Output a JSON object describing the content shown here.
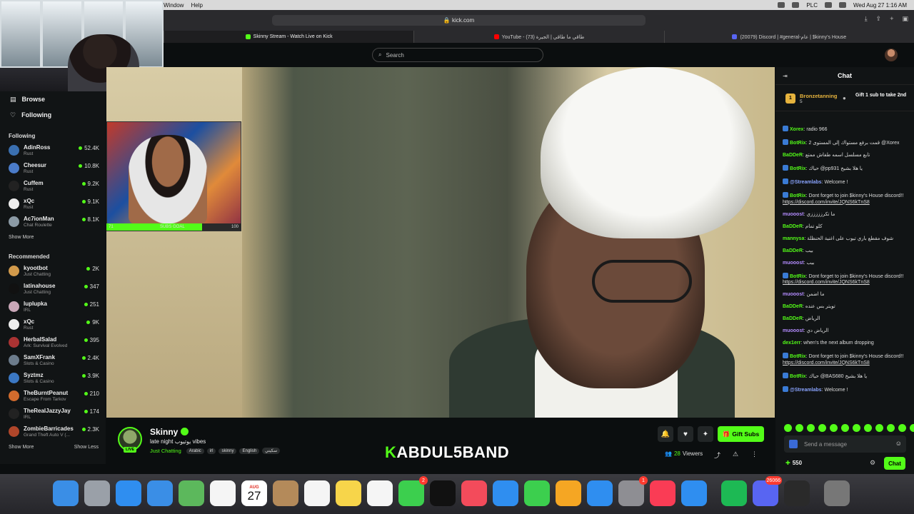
{
  "menubar": {
    "items": [
      "Window",
      "Help"
    ],
    "status": "PLC",
    "datetime": "Wed Aug 27  1:16 AM"
  },
  "browser": {
    "url": "kick.com",
    "tabs": [
      {
        "title": "Skinny Stream - Watch Live on Kick",
        "color": "#53fc18"
      },
      {
        "title": "YouTube - (73) طاقي ما طاقي | الجيرة",
        "color": "#ff0000"
      },
      {
        "title": "(20079) Discord | #general-عام | $kinny's House",
        "color": "#5865f2"
      }
    ]
  },
  "header": {
    "search_placeholder": "Search"
  },
  "sidebar": {
    "nav": [
      {
        "label": "Browse",
        "icon": "browse-icon"
      },
      {
        "label": "Following",
        "icon": "heart-icon"
      }
    ],
    "following_title": "Following",
    "following": [
      {
        "name": "AdinRoss",
        "category": "Rust",
        "viewers": "52.4K",
        "color": "#3a6fb0"
      },
      {
        "name": "Cheesur",
        "category": "Rust",
        "viewers": "10.8K",
        "color": "#4b7cc9"
      },
      {
        "name": "Cuffem",
        "category": "Rust",
        "viewers": "9.2K",
        "color": "#222"
      },
      {
        "name": "xQc",
        "category": "Rust",
        "viewers": "9.1K",
        "color": "#eee"
      },
      {
        "name": "Ac7ionMan",
        "category": "Chat Roulette",
        "viewers": "8.1K",
        "color": "#8b9aa5"
      }
    ],
    "show_more": "Show More",
    "recommended_title": "Recommended",
    "recommended": [
      {
        "name": "kyootbot",
        "category": "Just Chatting",
        "viewers": "2K",
        "color": "#d29a4b"
      },
      {
        "name": "latinahouse",
        "category": "Just Chatting",
        "viewers": "347",
        "color": "#111"
      },
      {
        "name": "luplupka",
        "category": "IRL",
        "viewers": "251",
        "color": "#c9a7b8"
      },
      {
        "name": "xQc",
        "category": "Rust",
        "viewers": "9K",
        "color": "#eee"
      },
      {
        "name": "HerbalSalad",
        "category": "Ark: Survival Evolved",
        "viewers": "395",
        "color": "#a33"
      },
      {
        "name": "SamXFrank",
        "category": "Slots & Casino",
        "viewers": "2.4K",
        "color": "#6c7c8c"
      },
      {
        "name": "Syztmz",
        "category": "Slots & Casino",
        "viewers": "3.9K",
        "color": "#3b78c4"
      },
      {
        "name": "TheBurntPeanut",
        "category": "Escape From Tarkov",
        "viewers": "210",
        "color": "#d26b2d"
      },
      {
        "name": "TheRealJazzyJay",
        "category": "IRL",
        "viewers": "174",
        "color": "#222"
      },
      {
        "name": "ZombieBarricades",
        "category": "Grand Theft Auto V (...",
        "viewers": "2.3K",
        "color": "#b0462a"
      }
    ],
    "show_more_2": "Show More",
    "show_less": "Show Less"
  },
  "overlay": {
    "subs_goal_label": "SUBS GOAL",
    "subs_current": "71",
    "subs_target": "100",
    "subs_progress": 0.71
  },
  "stream": {
    "channel": "Skinny",
    "live": "LIVE",
    "title": "late night يوتيوب vibes",
    "category": "Just Chatting",
    "tags": [
      "Arabic",
      "irl",
      "skinny",
      "English",
      "سكيني"
    ],
    "brand_k": "K",
    "brand_rest": "ABDUL5BAND",
    "viewers": "28",
    "viewers_label": "Viewers",
    "gift_subs": "Gift Subs"
  },
  "chat": {
    "title": "Chat",
    "pinned": {
      "rank": "1",
      "user": "Bronzetanning",
      "subs": "5",
      "gift": "Gift 1 sub to take 2nd"
    },
    "messages": [
      {
        "user": "Xorex",
        "color": "#53fc18",
        "badge": true,
        "text": "radio 966"
      },
      {
        "user": "BotRix",
        "color": "#53fc18",
        "badge": true,
        "text": "قمت برفع مستواك إلى المستوى 2 @Xorex"
      },
      {
        "user": "BaDDeR",
        "color": "#53fc18",
        "badge": false,
        "text": "تابع مسلسل اسمه طفاش ممتع"
      },
      {
        "user": "BotRix",
        "color": "#53fc18",
        "badge": true,
        "text": "حياك @pp931 يا هلا بشيخ"
      },
      {
        "user": "@Streamlabs",
        "color": "#8aa4ff",
        "badge": true,
        "text": "Welcome !"
      },
      {
        "user": "BotRix",
        "color": "#53fc18",
        "badge": true,
        "text": "Dont forget to join $kinny's House discord!!",
        "link": "https://discord.com/invite/JQNS6kTnS8"
      },
      {
        "user": "muooost",
        "color": "#b48cff",
        "badge": false,
        "text": "ما تكرزززززي"
      },
      {
        "user": "BaDDeR",
        "color": "#53fc18",
        "badge": false,
        "text": "كلو تمام"
      },
      {
        "user": "mannysa",
        "color": "#53fc18",
        "badge": false,
        "text": "شوف مقطع باري تيوب على اغنية الحنظلة"
      },
      {
        "user": "BaDDeR",
        "color": "#53fc18",
        "badge": false,
        "text": "بيب"
      },
      {
        "user": "muooost",
        "color": "#b48cff",
        "badge": false,
        "text": "بيب"
      },
      {
        "user": "BotRix",
        "color": "#53fc18",
        "badge": true,
        "text": "Dont forget to join $kinny's House discord!!",
        "link": "https://discord.com/invite/JQNS6kTnS8"
      },
      {
        "user": "muooost",
        "color": "#b48cff",
        "badge": false,
        "text": "ما اضمن"
      },
      {
        "user": "BaDDeR",
        "color": "#53fc18",
        "badge": false,
        "text": "تويتر بس عنده"
      },
      {
        "user": "BaDDeR",
        "color": "#53fc18",
        "badge": false,
        "text": "الرياض"
      },
      {
        "user": "muooost",
        "color": "#b48cff",
        "badge": false,
        "text": "الرياض دي"
      },
      {
        "user": "dex1err",
        "color": "#53fc18",
        "badge": false,
        "text": "when's the next album dropping"
      },
      {
        "user": "BotRix",
        "color": "#53fc18",
        "badge": true,
        "text": "Dont forget to join $kinny's House discord!!",
        "link": "https://discord.com/invite/JQNS6kTnS8"
      },
      {
        "user": "BotRix",
        "color": "#53fc18",
        "badge": true,
        "text": "حياك @BAS680 يا هلا بشيخ"
      },
      {
        "user": "@Streamlabs",
        "color": "#8aa4ff",
        "badge": true,
        "text": "Welcome !"
      }
    ],
    "input_placeholder": "Send a message",
    "points": "550",
    "send_label": "Chat"
  },
  "dock": {
    "calendar_month": "AUG",
    "calendar_day": "27",
    "apps": [
      {
        "name": "finder-icon",
        "color": "#3a8ee6"
      },
      {
        "name": "launchpad-icon",
        "color": "#9aa0a8"
      },
      {
        "name": "safari-icon",
        "color": "#2f8ef0"
      },
      {
        "name": "mail-icon",
        "color": "#3a8ee6"
      },
      {
        "name": "maps-icon",
        "color": "#5cb85c"
      },
      {
        "name": "photos-icon",
        "color": "#f5f5f5"
      },
      {
        "name": "calendar-icon",
        "color": "#ffffff"
      },
      {
        "name": "contacts-icon",
        "color": "#b48a5a"
      },
      {
        "name": "reminders-icon",
        "color": "#f5f5f5"
      },
      {
        "name": "notes-icon",
        "color": "#f7d54a"
      },
      {
        "name": "freeform-icon",
        "color": "#f5f5f5"
      },
      {
        "name": "facetime-icon",
        "color": "#3ccf4e",
        "badge": "2"
      },
      {
        "name": "tv-icon",
        "color": "#111111"
      },
      {
        "name": "news-icon",
        "color": "#f34b5b"
      },
      {
        "name": "keynote-icon",
        "color": "#2f8ef0"
      },
      {
        "name": "numbers-icon",
        "color": "#3ccf4e"
      },
      {
        "name": "pages-icon",
        "color": "#f5a623"
      },
      {
        "name": "appstore-icon",
        "color": "#2f8ef0"
      },
      {
        "name": "settings-icon",
        "color": "#8e8e93",
        "badge": "1"
      },
      {
        "name": "music-icon",
        "color": "#fa3c55"
      },
      {
        "name": "bluetooth-icon",
        "color": "#2f8ef0"
      },
      {
        "name": "spotify-icon",
        "color": "#1db954"
      },
      {
        "name": "discord-icon",
        "color": "#5865f2",
        "badge": "26066"
      },
      {
        "name": "obs-icon",
        "color": "#2a2a2a"
      },
      {
        "name": "trash-icon",
        "color": "#777777"
      }
    ]
  }
}
